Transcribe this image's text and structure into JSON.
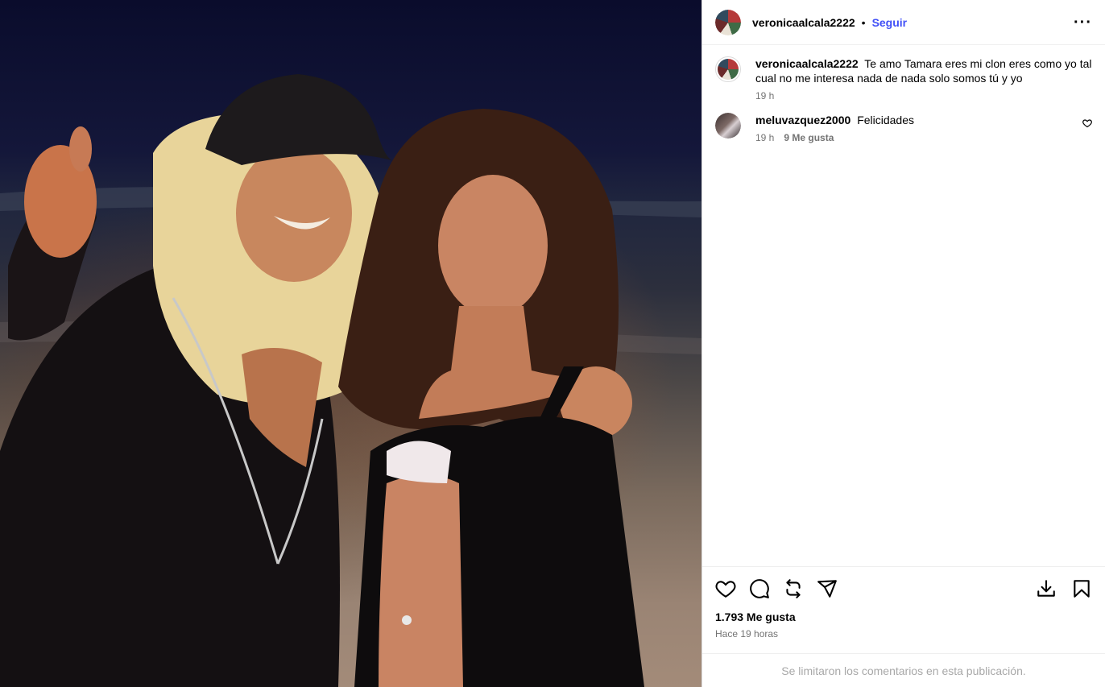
{
  "post": {
    "username": "veronicaalcala2222",
    "follow_label": "Seguir",
    "separator": "•",
    "more_label": "···"
  },
  "comments": [
    {
      "username": "veronicaalcala2222",
      "text": "Te amo Tamara eres mi clon eres como yo tal cual no me interesa nada de nada solo somos tú y yo",
      "time": "19 h",
      "likes": ""
    },
    {
      "username": "meluvazquez2000",
      "text": "Felicidades",
      "time": "19 h",
      "likes": "9 Me gusta"
    }
  ],
  "actions": {
    "icons": [
      "heart-icon",
      "comment-icon",
      "repost-icon",
      "share-icon",
      "download-icon",
      "bookmark-icon"
    ],
    "likes_label": "1.793 Me gusta",
    "time_ago": "Hace 19 horas"
  },
  "footer": {
    "limited_text": "Se limitaron los comentarios en esta publicación."
  },
  "colors": {
    "accent": "#4150f7",
    "secondary_text": "#737373",
    "muted_text": "#a8a8a8"
  }
}
